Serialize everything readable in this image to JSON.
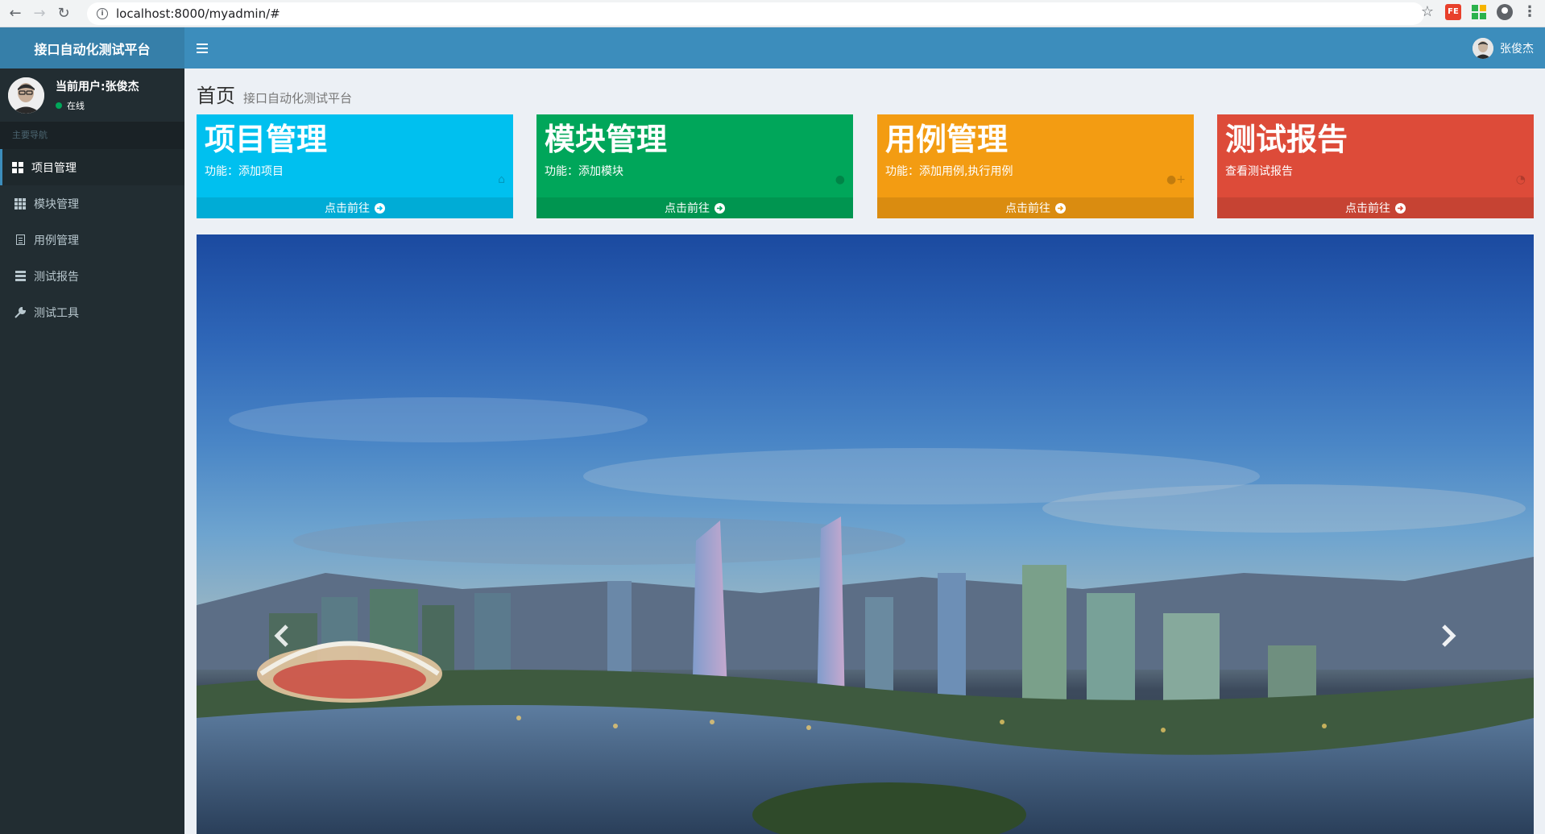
{
  "browser": {
    "url": "localhost:8000/myadmin/#",
    "ext_fe_label": "FE"
  },
  "header": {
    "logo": "接口自动化测试平台",
    "user_name": "张俊杰"
  },
  "sidebar": {
    "current_user": "当前用户:张俊杰",
    "status": "在线",
    "section_header": "主要导航",
    "items": [
      {
        "label": "项目管理",
        "icon": "dashboard-icon",
        "active": true
      },
      {
        "label": "模块管理",
        "icon": "th-icon",
        "active": false
      },
      {
        "label": "用例管理",
        "icon": "list-alt-icon",
        "active": false
      },
      {
        "label": "测试报告",
        "icon": "list-icon",
        "active": false
      },
      {
        "label": "测试工具",
        "icon": "wrench-icon",
        "active": false
      }
    ]
  },
  "page": {
    "title": "首页",
    "subtitle": "接口自动化测试平台"
  },
  "boxes": [
    {
      "title": "项目管理",
      "desc": "功能：添加项目",
      "footer": "点击前往",
      "color": "#00c0ef",
      "icon": "home-icon"
    },
    {
      "title": "模块管理",
      "desc": "功能：添加模块",
      "footer": "点击前往",
      "color": "#00a65a",
      "icon": "user-icon"
    },
    {
      "title": "用例管理",
      "desc": "功能：添加用例,执行用例",
      "footer": "点击前往",
      "color": "#f39c12",
      "icon": "user-plus-icon"
    },
    {
      "title": "测试报告",
      "desc": "查看测试报告",
      "footer": "点击前往",
      "color": "#dd4b39",
      "icon": "pie-chart-icon"
    }
  ],
  "colors": {
    "header": "#3c8dbc",
    "logo_bg": "#367fa9",
    "sidebar": "#222d32"
  }
}
